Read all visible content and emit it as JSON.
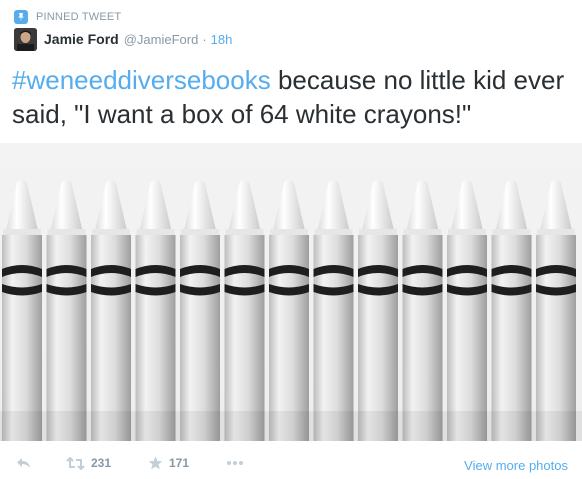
{
  "pinned": {
    "label": "PINNED TWEET",
    "icon": "pin-icon"
  },
  "author": {
    "name": "Jamie Ford",
    "handle": "@JamieFord",
    "separator": "·",
    "time": "18h"
  },
  "tweet": {
    "hashtag": "#weneeddiversebooks",
    "text": " because no little kid ever said, \"I want a box of 64 white crayons!\""
  },
  "photo": {
    "subject": "white-crayons-photo",
    "crayon_count": 13
  },
  "actions": {
    "retweets": "231",
    "favorites": "171",
    "more_photos": "View more photos"
  },
  "colors": {
    "accent": "#55acee",
    "muted": "#8899a6",
    "text": "#292f33"
  }
}
